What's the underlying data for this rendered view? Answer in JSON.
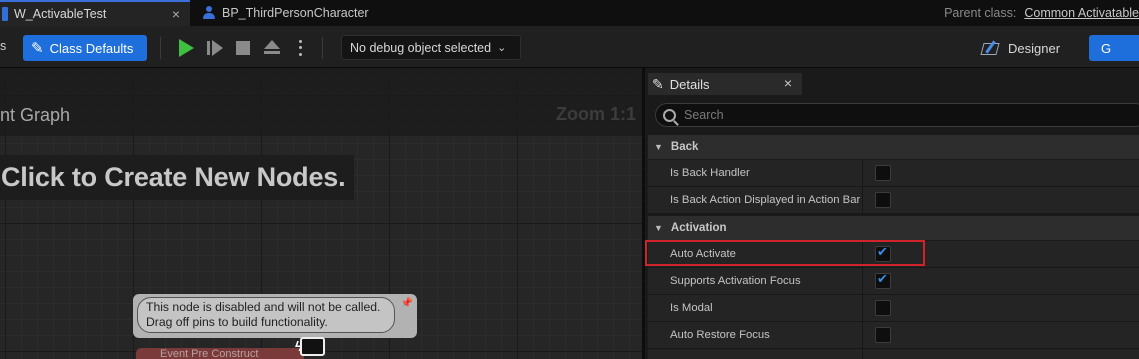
{
  "tabs": [
    {
      "label": "W_ActivableTest",
      "icon": "widget-blueprint-icon",
      "active": true,
      "close": "×"
    },
    {
      "label": "BP_ThirdPersonCharacter",
      "icon": "blueprint-person-icon",
      "active": false
    }
  ],
  "parent_class": {
    "label": "Parent class:",
    "value": "Common Activatable"
  },
  "toolbar": {
    "left_partial": "s",
    "class_defaults": "Class Defaults",
    "debug_select": "No debug object selected",
    "designer": "Designer",
    "graph": "G",
    "icons": [
      "pencil-icon",
      "play-icon",
      "step-icon",
      "stop-icon",
      "eject-icon",
      "kebab-icon",
      "chevron-down-icon",
      "designer-icon",
      "graph-icon"
    ]
  },
  "graph": {
    "title": "nt Graph",
    "zoom": "Zoom 1:1",
    "hint": "Click to Create New Nodes.",
    "node_comment_line1": "This node is disabled and will not be called.",
    "node_comment_line2": "Drag off pins to build functionality.",
    "node_title": "Event Pre Construct"
  },
  "details": {
    "tab": "Details",
    "close": "×",
    "search_placeholder": "Search",
    "sections": [
      {
        "name": "Back",
        "rows": [
          {
            "label": "Is Back Handler",
            "checked": false
          },
          {
            "label": "Is Back Action Displayed in Action Bar",
            "checked": false
          }
        ]
      },
      {
        "name": "Activation",
        "rows": [
          {
            "label": "Auto Activate",
            "checked": true
          },
          {
            "label": "Supports Activation Focus",
            "checked": true
          },
          {
            "label": "Is Modal",
            "checked": false
          },
          {
            "label": "Auto Restore Focus",
            "checked": false
          }
        ]
      }
    ]
  },
  "colors": {
    "accent": "#1e6fdc",
    "highlight": "#d0242a",
    "play": "#3fbf3f",
    "check": "#3a8ae8"
  }
}
